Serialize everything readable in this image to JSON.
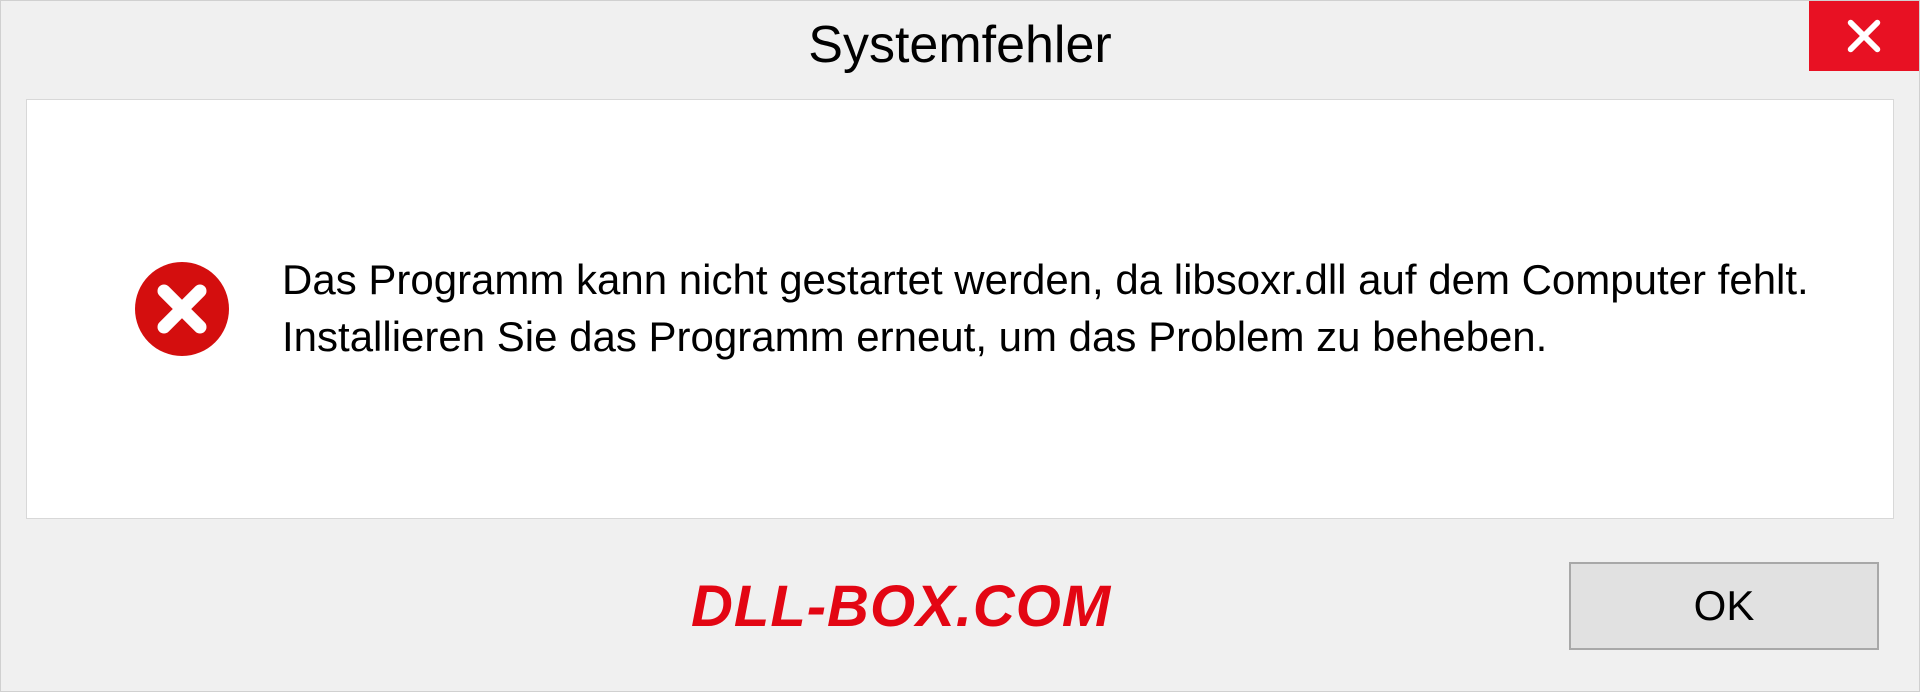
{
  "dialog": {
    "title": "Systemfehler",
    "message": "Das Programm kann nicht gestartet werden, da libsoxr.dll auf dem Computer fehlt. Installieren Sie das Programm erneut, um das Problem zu beheben.",
    "ok_label": "OK"
  },
  "watermark": "DLL-BOX.COM",
  "colors": {
    "close_bg": "#e81123",
    "error_red": "#d40e0e",
    "watermark_red": "#e30613"
  }
}
